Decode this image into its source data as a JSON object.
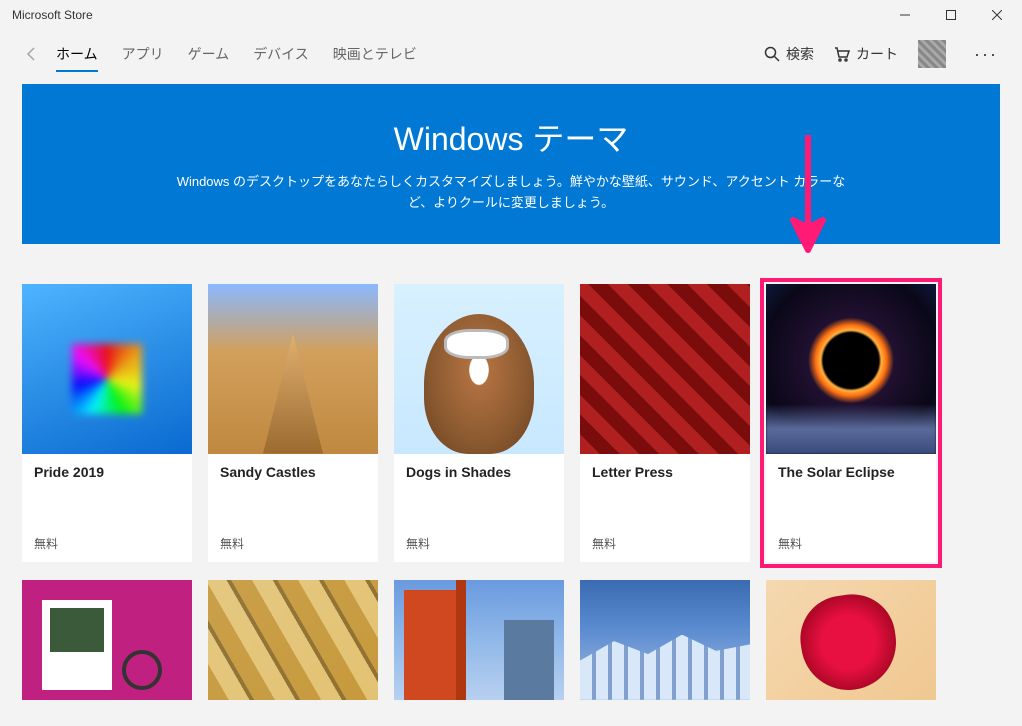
{
  "window": {
    "title": "Microsoft Store"
  },
  "nav": {
    "items": [
      "ホーム",
      "アプリ",
      "ゲーム",
      "デバイス",
      "映画とテレビ"
    ],
    "activeIndex": 0
  },
  "header": {
    "search": "検索",
    "cart": "カート"
  },
  "hero": {
    "title": "Windows テーマ",
    "subtitle": "Windows のデスクトップをあなたらしくカスタマイズしましょう。鮮やかな壁紙、サウンド、アクセント カラーなど、よりクールに変更しましょう。"
  },
  "cards": [
    {
      "title": "Pride 2019",
      "price": "無料"
    },
    {
      "title": "Sandy Castles",
      "price": "無料"
    },
    {
      "title": "Dogs in Shades",
      "price": "無料"
    },
    {
      "title": "Letter Press",
      "price": "無料"
    },
    {
      "title": "The Solar Eclipse",
      "price": "無料"
    }
  ],
  "highlightedIndex": 4,
  "colors": {
    "accent": "#0078d4",
    "highlight": "#ff1a75"
  }
}
